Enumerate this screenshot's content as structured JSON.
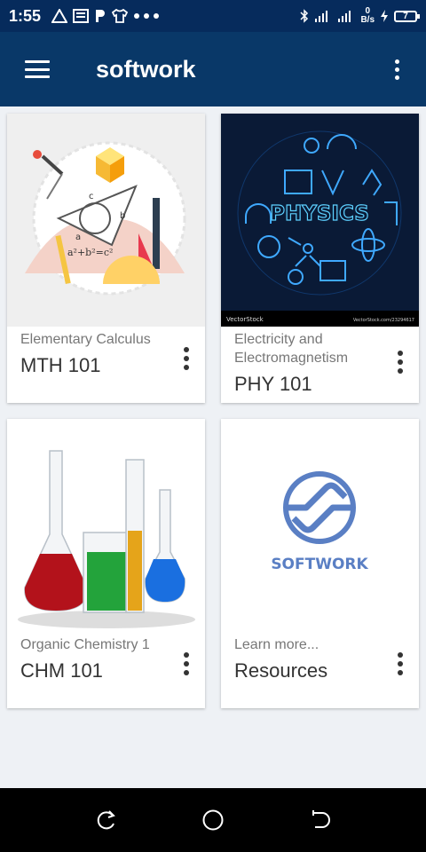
{
  "status": {
    "time": "1:55",
    "left_icons": [
      "warning-icon",
      "news-icon",
      "p-icon",
      "shirt-icon",
      "more-dots-icon"
    ],
    "speed_value": "0",
    "speed_unit": "B/s",
    "battery": "7"
  },
  "app": {
    "title": "softwork"
  },
  "cards": [
    {
      "subtitle": "Elementary Calculus",
      "title": "MTH 101",
      "image": "calculus-illustration",
      "formula": "a²+b²=c²"
    },
    {
      "subtitle": "Electricity and Electromagnetism",
      "title": "PHY 101",
      "image": "physics-neon-illustration",
      "banner": "PHYSICS",
      "credit_left": "VectorStock",
      "credit_right": "VectorStock.com/23294617"
    },
    {
      "subtitle": "Organic Chemistry 1",
      "title": "CHM 101",
      "image": "chemistry-flasks-photo"
    },
    {
      "subtitle": "Learn more...",
      "title": "Resources",
      "image": "softwork-logo",
      "logo_text": "SOFTWORK"
    }
  ],
  "colors": {
    "status_bar": "#062b5c",
    "app_bar": "#093868",
    "background": "#eef1f5",
    "logo_blue": "#5a7fc4"
  }
}
